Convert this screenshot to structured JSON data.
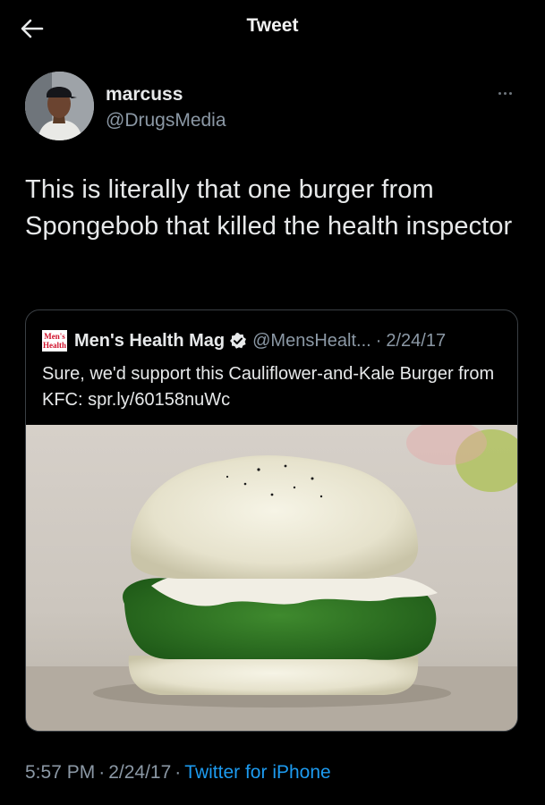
{
  "header": {
    "title": "Tweet",
    "back_icon": "arrow-left-icon"
  },
  "tweet": {
    "author": {
      "display_name": "marcuss",
      "handle": "@DrugsMedia"
    },
    "more_icon": "more-horizontal-icon",
    "text": "This is literally that one burger from Spongebob that killed the health inspector",
    "quote": {
      "logo_text_line1": "Men's",
      "logo_text_line2": "Health",
      "author_name": "Men's Health Mag",
      "verified_icon": "verified-badge-icon",
      "handle": "@MensHealt...",
      "separator": "·",
      "date": "2/24/17",
      "text": "Sure, we'd support this Cauliflower-and-Kale Burger from KFC: spr.ly/60158nuWc"
    },
    "meta": {
      "time": "5:57 PM",
      "separator": "·",
      "date": "2/24/17",
      "source": "Twitter for iPhone"
    }
  },
  "colors": {
    "background": "#000000",
    "text": "#e7e9ea",
    "muted": "#8b98a5",
    "link": "#1d9bf0",
    "border": "#3a3f44"
  }
}
